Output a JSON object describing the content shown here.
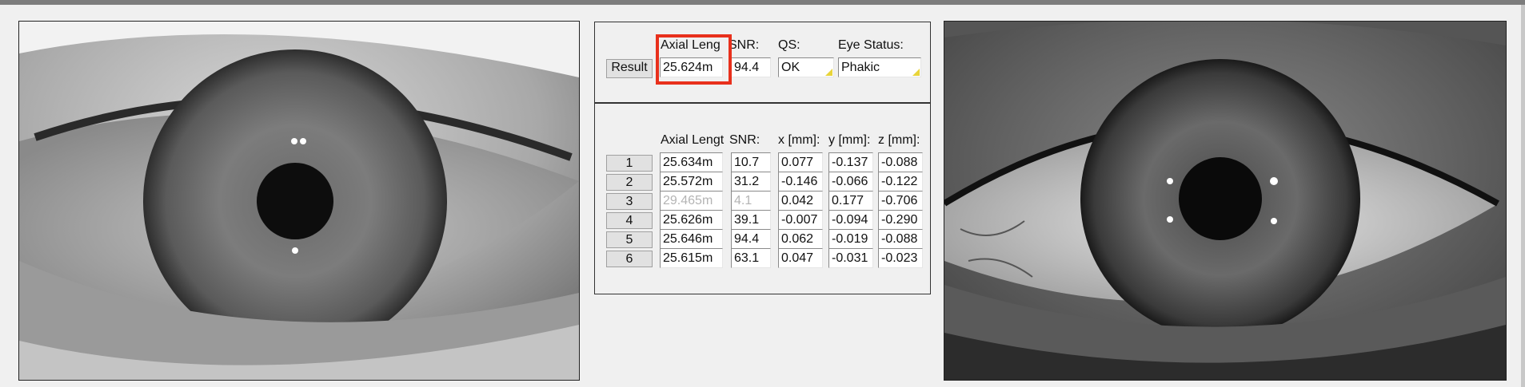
{
  "result": {
    "button_label": "Result",
    "headers": {
      "axial_length": "Axial Leng",
      "snr": "SNR:",
      "qs": "QS:",
      "eye_status": "Eye Status:"
    },
    "values": {
      "axial_length": "25.624m",
      "snr": "94.4",
      "qs": "OK",
      "eye_status": "Phakic"
    }
  },
  "measurements": {
    "headers": {
      "axial_length": "Axial Lengt",
      "snr": "SNR:",
      "x": "x [mm]:",
      "y": "y [mm]:",
      "z": "z [mm]:"
    },
    "rows": [
      {
        "label": "1",
        "axial_length": "25.634m",
        "snr": "10.7",
        "x": "0.077",
        "y": "-0.137",
        "z": "-0.088"
      },
      {
        "label": "2",
        "axial_length": "25.572m",
        "snr": "31.2",
        "x": "-0.146",
        "y": "-0.066",
        "z": "-0.122"
      },
      {
        "label": "3",
        "axial_length": "29.465m",
        "snr": "4.1",
        "x": "0.042",
        "y": "0.177",
        "z": "-0.706"
      },
      {
        "label": "4",
        "axial_length": "25.626m",
        "snr": "39.1",
        "x": "-0.007",
        "y": "-0.094",
        "z": "-0.290"
      },
      {
        "label": "5",
        "axial_length": "25.646m",
        "snr": "94.4",
        "x": "0.062",
        "y": "-0.019",
        "z": "-0.088"
      },
      {
        "label": "6",
        "axial_length": "25.615m",
        "snr": "63.1",
        "x": "0.047",
        "y": "-0.031",
        "z": "-0.023"
      }
    ]
  },
  "colors": {
    "highlight": "#e8301c",
    "dropdown_marker": "#e8d43a"
  }
}
